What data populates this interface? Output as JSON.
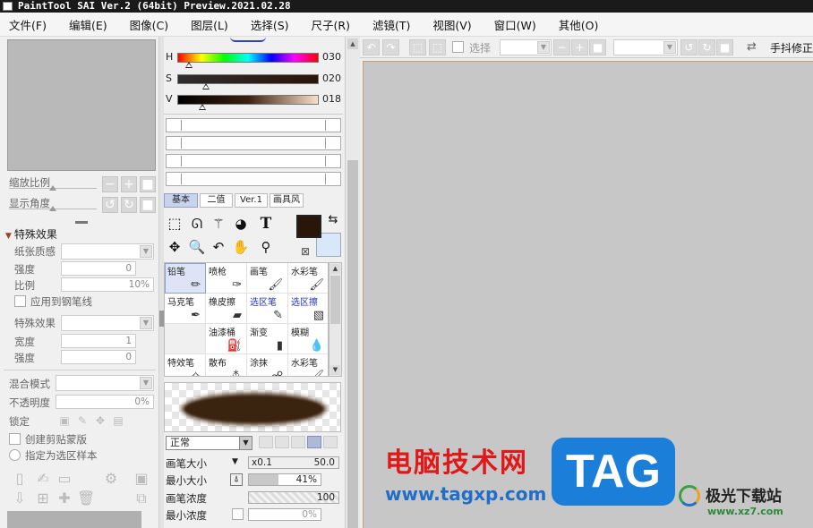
{
  "window": {
    "title": "PaintTool SAI Ver.2 (64bit) Preview.2021.02.28"
  },
  "menu": [
    "文件(F)",
    "编辑(E)",
    "图像(C)",
    "图层(L)",
    "选择(S)",
    "尺子(R)",
    "滤镜(T)",
    "视图(V)",
    "窗口(W)",
    "其他(O)"
  ],
  "navigator": {
    "zoom_label": "缩放比例",
    "angle_label": "显示角度"
  },
  "effects": {
    "header": "特殊效果",
    "paper_label": "纸张质感",
    "strength_label": "强度",
    "strength_value": "0",
    "scale_label": "比例",
    "scale_value": "10%",
    "apply_pen_label": "应用到钢笔线",
    "effect_label": "特殊效果",
    "width_label": "宽度",
    "width_value": "1",
    "strength2_label": "强度",
    "strength2_value": "0"
  },
  "layer": {
    "blend_label": "混合模式",
    "opacity_label": "不透明度",
    "opacity_value": "0%",
    "lock_label": "锁定",
    "clip_label": "创建剪贴蒙版",
    "select_src_label": "指定为选区样本"
  },
  "color": {
    "h_label": "H",
    "h_value": "030",
    "s_label": "S",
    "s_value": "020",
    "v_label": "V",
    "v_value": "018",
    "h_pos": 0.08,
    "s_pos": 0.2,
    "v_pos": 0.18,
    "fg": "#2a1608",
    "bg": "#d8e8f8"
  },
  "tool_tabs": [
    "基本",
    "二值",
    "Ver.1",
    "画具风"
  ],
  "brushes": [
    {
      "name": "铅笔",
      "icon": "pencil-icon",
      "selected": true
    },
    {
      "name": "喷枪",
      "icon": "airbrush-icon"
    },
    {
      "name": "画笔",
      "icon": "brush-icon"
    },
    {
      "name": "水彩笔",
      "icon": "watercolor-icon"
    },
    {
      "name": "马克笔",
      "icon": "marker-icon"
    },
    {
      "name": "橡皮擦",
      "icon": "eraser-icon"
    },
    {
      "name": "选区笔",
      "icon": "select-pen-icon",
      "blue": true
    },
    {
      "name": "选区擦",
      "icon": "select-eraser-icon",
      "blue": true
    },
    {
      "name": "",
      "icon": "",
      "empty": true
    },
    {
      "name": "油漆桶",
      "icon": "bucket-icon"
    },
    {
      "name": "渐变",
      "icon": "gradient-icon"
    },
    {
      "name": "模糊",
      "icon": "blur-icon"
    },
    {
      "name": "特效笔",
      "icon": "fx-pen-icon"
    },
    {
      "name": "散布",
      "icon": "scatter-icon"
    },
    {
      "name": "涂抹",
      "icon": "smudge-icon"
    },
    {
      "name": "水彩笔",
      "icon": "watercolor-icon"
    }
  ],
  "brush_props": {
    "blend": "正常",
    "size_label": "画笔大小",
    "size_mult": "x0.1",
    "size_value": "50.0",
    "min_size_label": "最小大小",
    "min_size_value": "41%",
    "min_size_fill": 0.41,
    "density_label": "画笔浓度",
    "density_value": "100",
    "min_density_label": "最小浓度",
    "min_density_value": "0%"
  },
  "canvas_toolbar": {
    "select_label": "选择",
    "stabilizer_label": "手抖修正"
  },
  "watermark": {
    "title": "电脑技术网",
    "url": "www.tagxp.com",
    "tag": "TAG",
    "brand": "极光下载站",
    "brand_url": "www.xz7.com"
  }
}
